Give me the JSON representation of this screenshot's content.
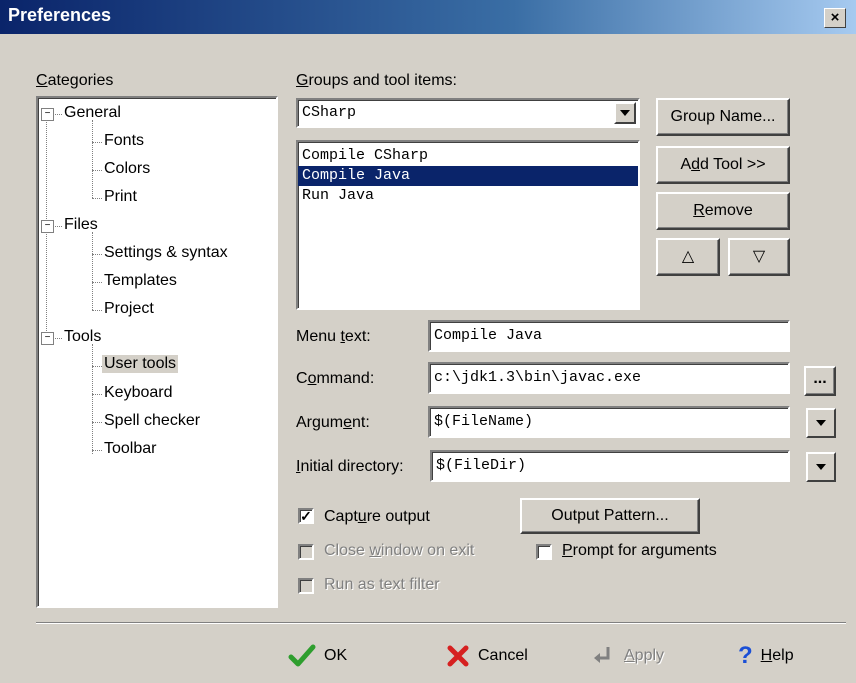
{
  "window": {
    "title": "Preferences",
    "close_glyph": "×"
  },
  "categories": {
    "label": "Categories",
    "tree": [
      {
        "label": "General",
        "children": [
          "Fonts",
          "Colors",
          "Print"
        ]
      },
      {
        "label": "Files",
        "children": [
          "Settings & syntax",
          "Templates",
          "Project"
        ]
      },
      {
        "label": "Tools",
        "children": [
          "User tools",
          "Keyboard",
          "Spell checker",
          "Toolbar"
        ]
      }
    ],
    "selected": "User tools"
  },
  "groups": {
    "label": "Groups and tool items:",
    "combo_value": "CSharp",
    "items": [
      "Compile CSharp",
      "Compile Java",
      "Run Java"
    ],
    "selected_item": "Compile Java"
  },
  "buttons": {
    "group_name": "Group Name...",
    "add_tool": "Add Tool >>",
    "remove": "Remove",
    "up_glyph": "△",
    "down_glyph": "▽",
    "output_pattern": "Output Pattern...",
    "ellipsis": "..."
  },
  "fields": {
    "menu_text": {
      "label": "Menu text:",
      "value": "Compile Java"
    },
    "command": {
      "label": "Command:",
      "value": "c:\\jdk1.3\\bin\\javac.exe"
    },
    "argument": {
      "label": "Argument:",
      "value": "$(FileName)"
    },
    "initial_directory": {
      "label": "Initial directory:",
      "value": "$(FileDir)"
    }
  },
  "options": {
    "capture_output": {
      "label": "Capture output",
      "checked": true,
      "enabled": true
    },
    "close_window_on_exit": {
      "label": "Close window on exit",
      "checked": false,
      "enabled": false
    },
    "prompt_for_arguments": {
      "label": "Prompt for arguments",
      "checked": false,
      "enabled": true
    },
    "run_as_text_filter": {
      "label": "Run as text filter",
      "checked": false,
      "enabled": false
    }
  },
  "footer": {
    "ok": "OK",
    "cancel": "Cancel",
    "apply": "Apply",
    "help": "Help"
  },
  "colors": {
    "selection": "#0a246a",
    "ok_icon": "#2e9e2e",
    "cancel_icon": "#d62020",
    "help_icon": "#1a4fd6"
  }
}
